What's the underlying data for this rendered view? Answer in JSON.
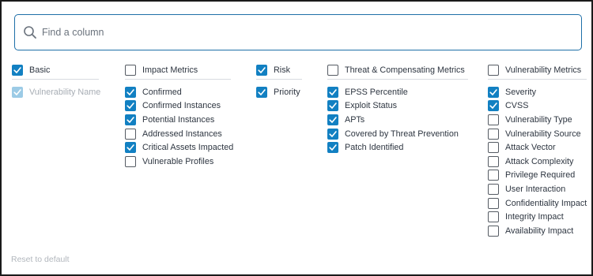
{
  "search": {
    "placeholder": "Find a column"
  },
  "groups": [
    {
      "key": "basic",
      "label": "Basic",
      "checked": true,
      "items": [
        {
          "label": "Vulnerability Name",
          "checked": true,
          "disabled": true
        }
      ]
    },
    {
      "key": "impact",
      "label": "Impact Metrics",
      "checked": false,
      "items": [
        {
          "label": "Confirmed",
          "checked": true
        },
        {
          "label": "Confirmed Instances",
          "checked": true
        },
        {
          "label": "Potential Instances",
          "checked": true
        },
        {
          "label": "Addressed Instances",
          "checked": false
        },
        {
          "label": "Critical Assets Impacted",
          "checked": true
        },
        {
          "label": "Vulnerable Profiles",
          "checked": false
        }
      ]
    },
    {
      "key": "risk",
      "label": "Risk",
      "checked": true,
      "items": [
        {
          "label": "Priority",
          "checked": true
        }
      ]
    },
    {
      "key": "threat",
      "label": "Threat & Compensating Metrics",
      "checked": false,
      "items": [
        {
          "label": "EPSS Percentile",
          "checked": true
        },
        {
          "label": "Exploit Status",
          "checked": true
        },
        {
          "label": "APTs",
          "checked": true
        },
        {
          "label": "Covered by Threat Prevention",
          "checked": true
        },
        {
          "label": "Patch Identified",
          "checked": true
        }
      ]
    },
    {
      "key": "vuln",
      "label": "Vulnerability Metrics",
      "checked": false,
      "items": [
        {
          "label": "Severity",
          "checked": true
        },
        {
          "label": "CVSS",
          "checked": true
        },
        {
          "label": "Vulnerability Type",
          "checked": false
        },
        {
          "label": "Vulnerability Source",
          "checked": false
        },
        {
          "label": "Attack Vector",
          "checked": false
        },
        {
          "label": "Attack Complexity",
          "checked": false
        },
        {
          "label": "Privilege Required",
          "checked": false
        },
        {
          "label": "User Interaction",
          "checked": false
        },
        {
          "label": "Confidentiality Impact",
          "checked": false
        },
        {
          "label": "Integrity Impact",
          "checked": false
        },
        {
          "label": "Availability Impact",
          "checked": false
        }
      ]
    }
  ],
  "footer": {
    "reset_label": "Reset to default"
  },
  "colors": {
    "accent": "#1280c2",
    "accent_disabled": "#9ccbe6",
    "border_focus": "#1e6fa8"
  }
}
